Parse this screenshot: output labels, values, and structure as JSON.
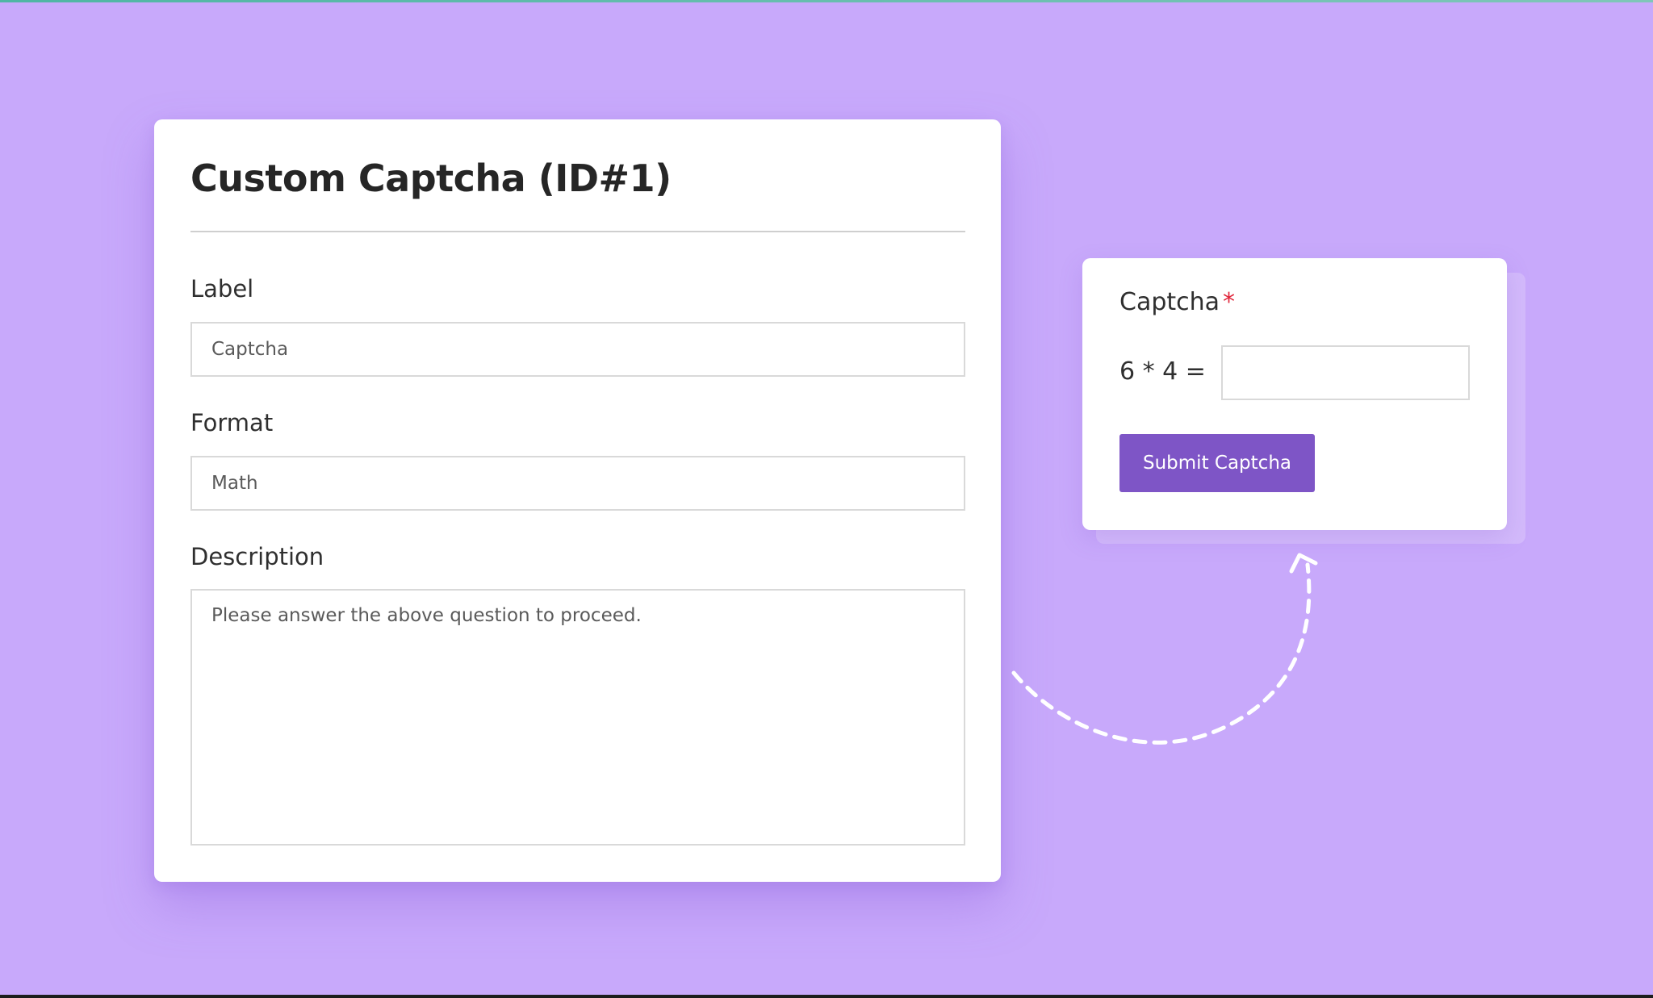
{
  "settings": {
    "title": "Custom Captcha (ID#1)",
    "label_heading": "Label",
    "label_value": "Captcha",
    "format_heading": "Format",
    "format_value": "Math",
    "description_heading": "Description",
    "description_value": "Please answer the above question to proceed."
  },
  "preview": {
    "field_label": "Captcha",
    "required_marker": "*",
    "question": "6 * 4 =",
    "answer_value": "",
    "submit_label": "Submit Captcha"
  },
  "colors": {
    "background": "#c8a9fb",
    "button": "#7e55c6",
    "required": "#e0253a"
  },
  "icons": {
    "connector": "dashed-curved-arrow-icon"
  }
}
